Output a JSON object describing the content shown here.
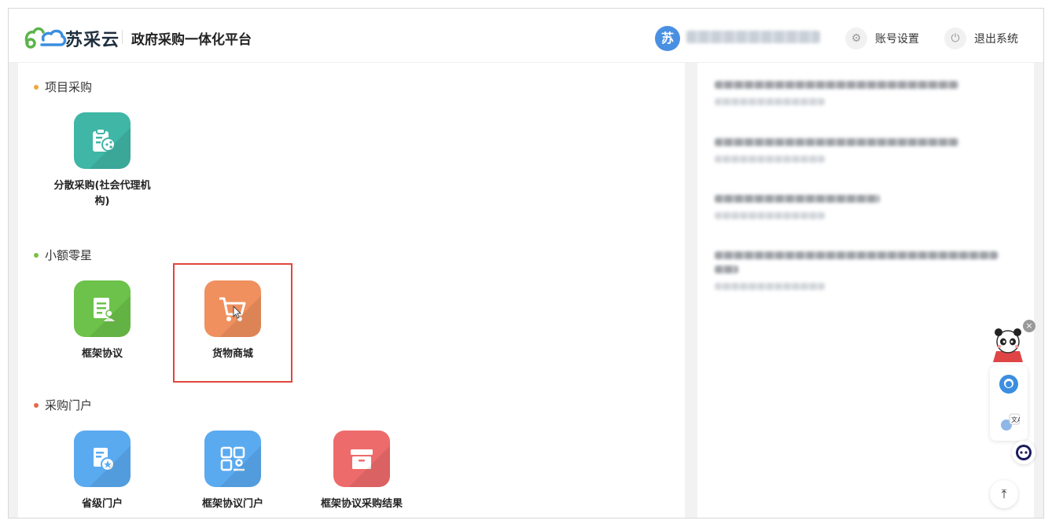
{
  "header": {
    "brand": "苏采云",
    "platform": "政府采购一体化平台",
    "avatar_text": "苏",
    "account_settings": "账号设置",
    "logout": "退出系统"
  },
  "sections": [
    {
      "title": "项目采购",
      "dot_color": "#f0a63c",
      "items": [
        {
          "label": "分散采购(社会代理机构)",
          "icon": "clipboard-share-icon",
          "color": "#3fb6a6"
        }
      ]
    },
    {
      "title": "小额零星",
      "dot_color": "#7bc043",
      "items": [
        {
          "label": "框架协议",
          "icon": "document-user-icon",
          "color": "#6cc24a"
        },
        {
          "label": "货物商城",
          "icon": "shopping-cart-icon",
          "color": "#f0905f"
        }
      ]
    },
    {
      "title": "采购门户",
      "dot_color": "#e8684a",
      "items": [
        {
          "label": "省级门户",
          "icon": "document-star-icon",
          "color": "#5aaaf0"
        },
        {
          "label": "框架协议门户",
          "icon": "grid-user-icon",
          "color": "#5aaaf0"
        },
        {
          "label": "框架协议采购结果",
          "icon": "archive-box-icon",
          "color": "#ee6b6b"
        }
      ]
    }
  ]
}
